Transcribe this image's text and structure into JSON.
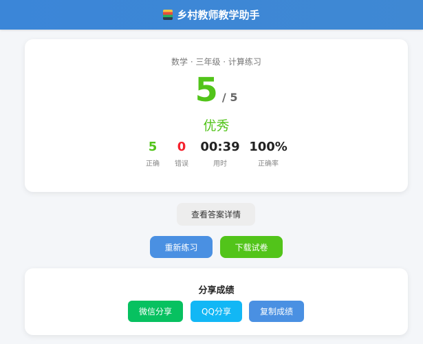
{
  "header": {
    "title": "乡村教师教学助手",
    "logo_icon": "books-icon"
  },
  "result": {
    "subject_line": "数学 · 三年级 · 计算练习",
    "score": "5",
    "total": "/ 5",
    "grade": "优秀",
    "stats": [
      {
        "value": "5",
        "label": "正确"
      },
      {
        "value": "0",
        "label": "错误"
      },
      {
        "value": "00:39",
        "label": "用时"
      },
      {
        "value": "100%",
        "label": "正确率"
      }
    ]
  },
  "actions": {
    "detail_label": "查看答案详情",
    "retry_label": "重新练习",
    "download_label": "下载试卷"
  },
  "share": {
    "title": "分享成绩",
    "wechat_label": "微信分享",
    "qq_label": "QQ分享",
    "copy_label": "复制成绩"
  },
  "colors": {
    "header": "#3b86d8",
    "success": "#52c41a",
    "error": "#f5222d",
    "primary": "#4a90e2",
    "wechat": "#07c160",
    "qq": "#12b7f5"
  }
}
